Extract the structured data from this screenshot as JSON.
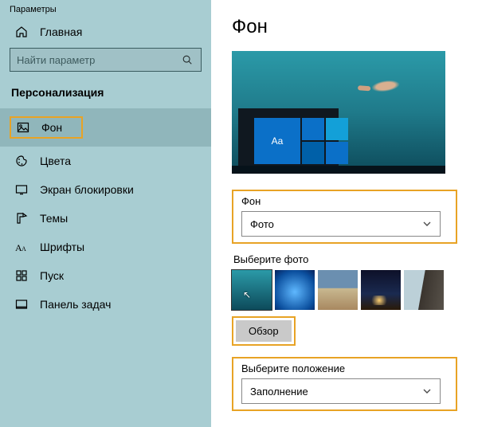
{
  "app_title": "Параметры",
  "home_label": "Главная",
  "search_placeholder": "Найти параметр",
  "section_title": "Персонализация",
  "nav": {
    "background": "Фон",
    "colors": "Цвета",
    "lockscreen": "Экран блокировки",
    "themes": "Темы",
    "fonts": "Шрифты",
    "start": "Пуск",
    "taskbar": "Панель задач"
  },
  "page_heading": "Фон",
  "preview_tile_text": "Aa",
  "bg_section": {
    "label": "Фон",
    "value": "Фото"
  },
  "choose_photo_label": "Выберите фото",
  "browse_label": "Обзор",
  "fit_section": {
    "label": "Выберите положение",
    "value": "Заполнение"
  }
}
